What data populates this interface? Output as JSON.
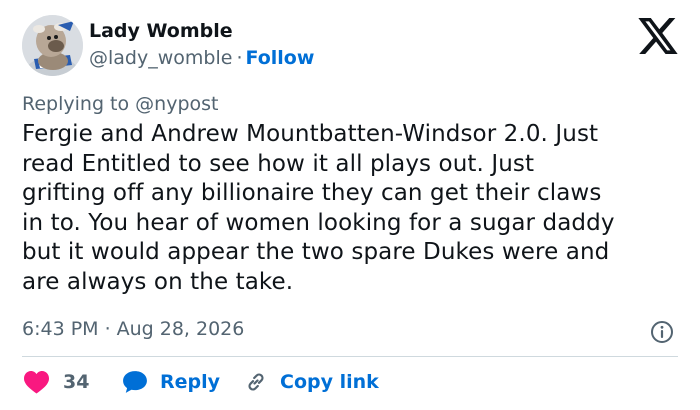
{
  "author": {
    "name": "Lady Womble",
    "handle": "@lady_womble",
    "separator": "·",
    "follow_label": "Follow"
  },
  "replying_to": {
    "prefix": "Replying to",
    "mention": "@nypost"
  },
  "tweet": {
    "lines": [
      "Fergie and Andrew Mountbatten-Windsor 2.0. Just",
      "read Entitled to see how it all plays out. Just",
      "grifting off any billionaire they can get their claws",
      "in to. You hear of women looking for a sugar daddy",
      "but it would appear the two spare Dukes were and",
      "are always on the take."
    ]
  },
  "meta": {
    "time": "6:43 PM",
    "separator": "·",
    "date": "Aug 28, 2026"
  },
  "actions": {
    "like_count": "34",
    "reply_label": "Reply",
    "copy_link_label": "Copy link"
  },
  "icons": {
    "brand": "x-logo-icon",
    "info": "info-icon",
    "like": "heart-icon",
    "reply": "speech-bubble-icon",
    "copy": "link-icon"
  },
  "colors": {
    "text": "#0f1419",
    "secondary": "#536471",
    "link": "#006fd6",
    "like": "#f91880",
    "divider": "#cfd9de"
  }
}
